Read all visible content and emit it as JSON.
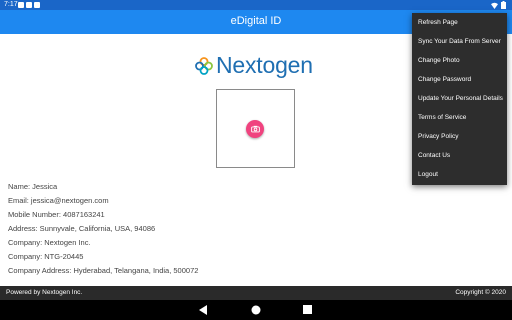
{
  "status_bar": {
    "time": "7:17"
  },
  "app_bar": {
    "title": "eDigital ID"
  },
  "logo": {
    "text": "Nextogen"
  },
  "profile": {
    "rows": [
      "Name: Jessica",
      "Email: jessica@nextogen.com",
      "Mobile Number: 4087163241",
      "Address: Sunnyvale, California, USA, 94086",
      "Company: Nextogen Inc.",
      "Company: NTG-20445",
      "Company Address: Hyderabad, Telangana, India, 500072"
    ]
  },
  "footer": {
    "left": "Powered by Nextogen Inc.",
    "right": "Copyright © 2020"
  },
  "menu": {
    "items": [
      "Refresh Page",
      "Sync Your Data From Server",
      "Change Photo",
      "Change Password",
      "Update Your Personal Details",
      "Terms of Service",
      "Privacy Policy",
      "Contact Us",
      "Logout"
    ]
  },
  "colors": {
    "status_bar": "#1a66c8",
    "app_bar": "#1e88f0",
    "fab": "#f0437f",
    "menu_bg": "#2d2d2d",
    "footer_bg": "#2a2a2a"
  },
  "icons": [
    "wifi-icon",
    "battery-icon",
    "camera-icon",
    "back-icon",
    "home-icon",
    "recents-icon"
  ]
}
